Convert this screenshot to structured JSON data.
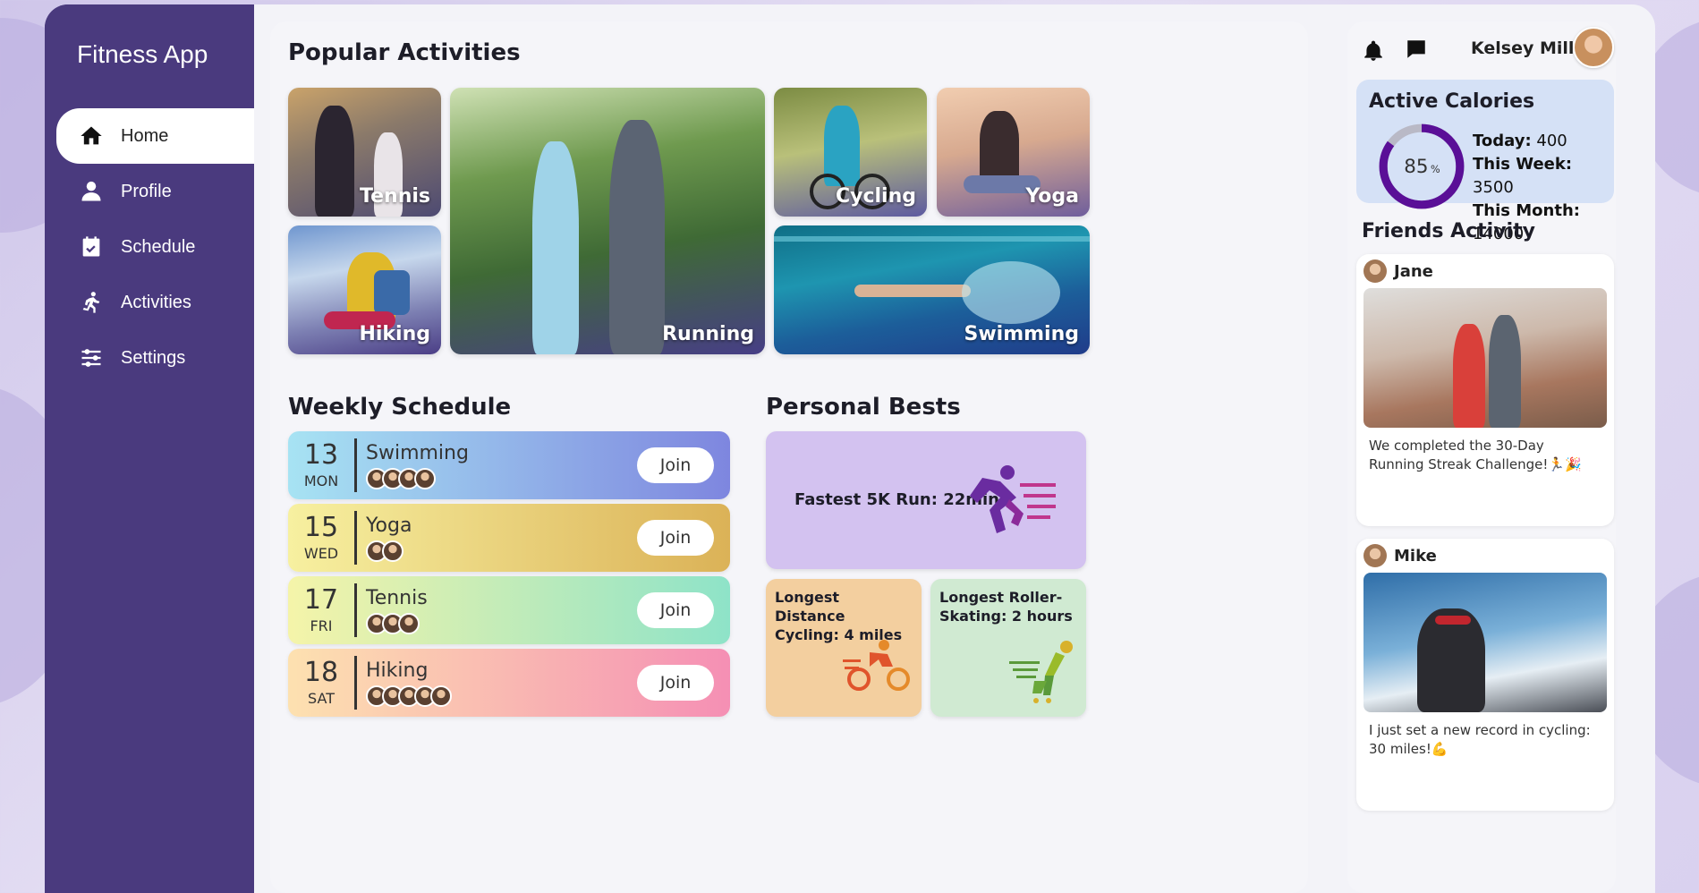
{
  "app": {
    "brand": "Fitness App"
  },
  "nav": {
    "items": [
      {
        "label": "Home",
        "icon": "home-icon",
        "active": true
      },
      {
        "label": "Profile",
        "icon": "user-icon"
      },
      {
        "label": "Schedule",
        "icon": "calendar-icon"
      },
      {
        "label": "Activities",
        "icon": "running-icon"
      },
      {
        "label": "Settings",
        "icon": "sliders-icon"
      }
    ]
  },
  "popular": {
    "title": "Popular Activities",
    "tiles": [
      "Tennis",
      "Running",
      "Cycling",
      "Yoga",
      "Hiking",
      "Swimming"
    ]
  },
  "schedule": {
    "title": "Weekly Schedule",
    "join_label": "Join",
    "items": [
      {
        "day": "13",
        "weekday": "MON",
        "name": "Swimming",
        "attendees": 4,
        "gradient": [
          "#a7e3f3",
          "#7e86df"
        ]
      },
      {
        "day": "15",
        "weekday": "WED",
        "name": "Yoga",
        "attendees": 2,
        "gradient": [
          "#f7f0a0",
          "#dbb257"
        ]
      },
      {
        "day": "17",
        "weekday": "FRI",
        "name": "Tennis",
        "attendees": 3,
        "gradient": [
          "#f5f4a9",
          "#8ee3c8"
        ]
      },
      {
        "day": "18",
        "weekday": "SAT",
        "name": "Hiking",
        "attendees": 5,
        "gradient": [
          "#fde1b0",
          "#f58fb4"
        ]
      }
    ]
  },
  "bests": {
    "title": "Personal Bests",
    "fastest": "Fastest 5K Run: 22min",
    "cycling": "Longest Distance Cycling: 4 miles",
    "skating": "Longest Roller-Skating: 2 hours",
    "colors": {
      "fastest": "#d3c2f0",
      "cycling": "#f3cf9f",
      "skating": "#d0ead2"
    }
  },
  "header": {
    "username": "Kelsey Miller"
  },
  "calories": {
    "title": "Active Calories",
    "percent": 85,
    "percent_text": "85",
    "percent_unit": "%",
    "today_label": "Today:",
    "today_value": "400",
    "week_label": "This Week:",
    "week_value": "3500",
    "month_label": "This Month:",
    "month_value": "14000"
  },
  "friends": {
    "title": "Friends Activity",
    "posts": [
      {
        "name": "Jane",
        "caption": "We completed the 30-Day Running Streak Challenge!🏃🎉"
      },
      {
        "name": "Mike",
        "caption": "I just set a new record in cycling: 30 miles!💪"
      }
    ]
  }
}
